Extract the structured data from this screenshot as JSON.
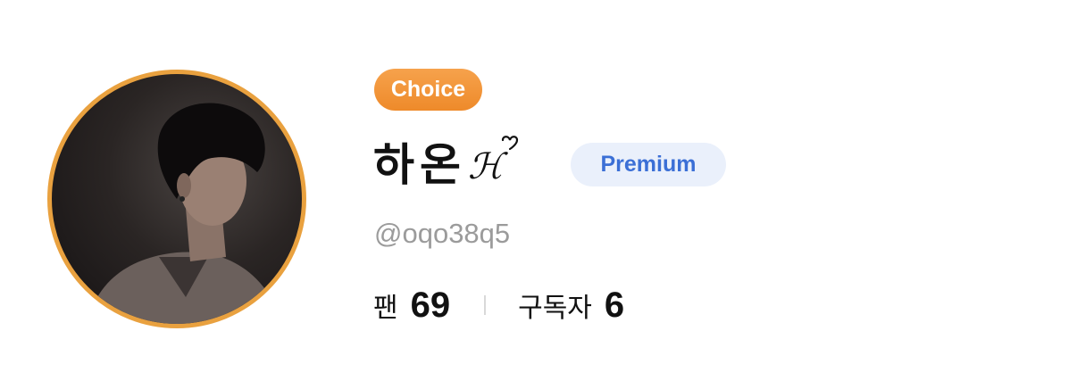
{
  "profile": {
    "badge": "Choice",
    "name": "하온",
    "name_decoration": "ℋ",
    "name_decoration_icon": "heart-icon",
    "tier": "Premium",
    "handle": "@oqo38q5",
    "stats": [
      {
        "label": "팬",
        "value": "69"
      },
      {
        "label": "구독자",
        "value": "6"
      }
    ]
  },
  "colors": {
    "avatar_ring": "#E9A13F",
    "choice_badge": "#F29435",
    "premium_text": "#3B6FD6",
    "premium_bg": "#EAF0FB",
    "handle_text": "#9B9B9B"
  }
}
